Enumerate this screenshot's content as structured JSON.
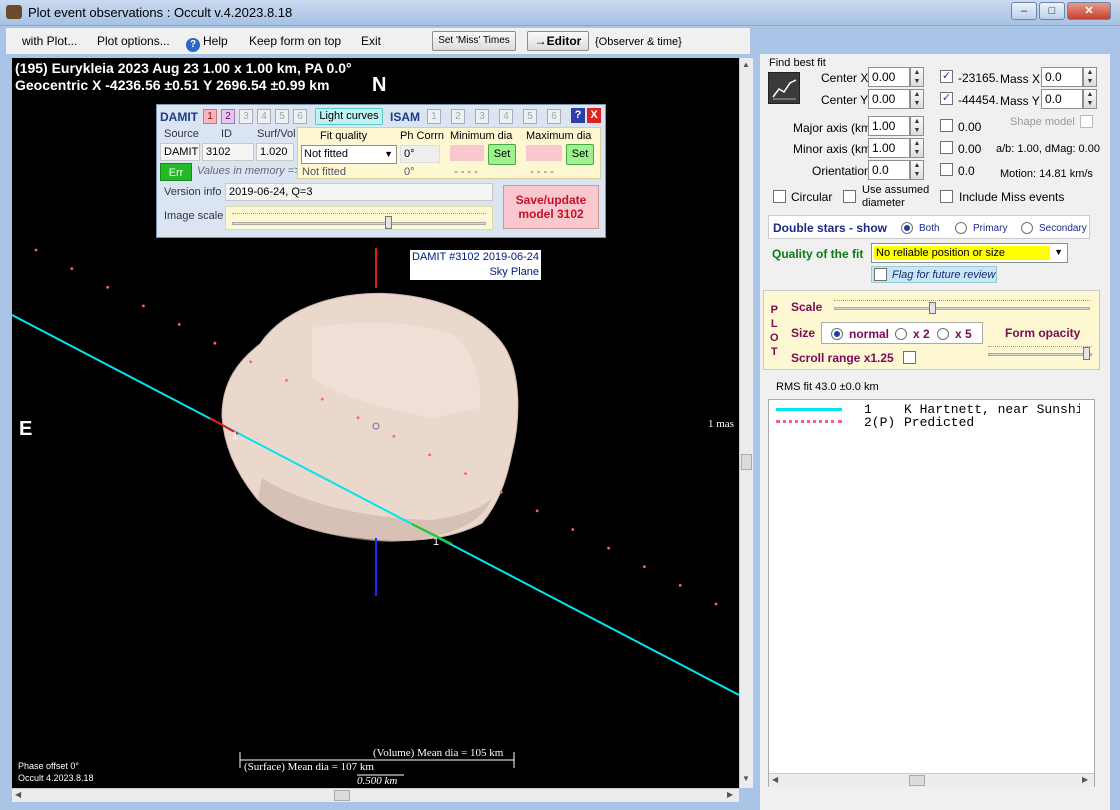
{
  "window": {
    "title": "Plot event observations : Occult v.4.2023.8.18"
  },
  "menu": {
    "with_plot": "with Plot...",
    "plot_options": "Plot options...",
    "help": "Help",
    "keep_on_top": "Keep form on top",
    "exit": "Exit",
    "set_miss_times": "Set 'Miss' Times",
    "editor": "→Editor",
    "observer_time": "{Observer & time}"
  },
  "plot": {
    "header_line1": "(195) Eurykleia  2023 Aug 23   1.00 x 1.00 km, PA 0.0°",
    "header_line2": "Geocentric  X  -4236.56 ±0.51  Y 2696.54 ±0.99 km",
    "north": "N",
    "east": "E",
    "model_label_line1": "DAMIT #3102 2019-06-24",
    "model_label_line2": "Sky Plane",
    "mas_label": "1 mas",
    "chord_label_a": "1",
    "chord_label_b": "1",
    "volume_dia": "(Volume) Mean dia = 105 km",
    "surface_dia": "(Surface) Mean dia = 107 km",
    "scale_km": "0.500 km",
    "phase_offset": "Phase offset 0°",
    "version": "Occult 4.2023.8.18"
  },
  "damit_panel": {
    "damit_label": "DAMIT",
    "model_numbers": [
      "1",
      "2",
      "3",
      "4",
      "5",
      "6"
    ],
    "light_curves": "Light curves",
    "isam_label": "ISAM",
    "isam_numbers": [
      "1",
      "2",
      "3",
      "4",
      "5",
      "6"
    ],
    "help_btn": "?",
    "close_btn": "X",
    "source_hdr": "Source",
    "id_hdr": "ID",
    "surfvol_hdr": "Surf/Vol",
    "source_val": "DAMIT",
    "id_val": "3102",
    "surfvol_val": "1.020",
    "err_btn": "Err",
    "values_in_memory": "Values in memory =>",
    "fit_quality_hdr": "Fit quality",
    "ph_corr_hdr": "Ph Corrn",
    "min_dia_hdr": "Minimum dia",
    "max_dia_hdr": "Maximum dia",
    "fit_select": "Not fitted",
    "fit_memory": "Not fitted",
    "ph_corr_val": "0°",
    "ph_corr_memory": "0°",
    "set_btn": "Set",
    "dashes": "- - - -",
    "version_info_label": "Version info",
    "version_info_val": "2019-06-24, Q=3",
    "image_scale_label": "Image scale",
    "image_scale_pos": 0.62,
    "save_update": "Save/update",
    "save_model": "model 3102"
  },
  "right_panel": {
    "find_best_fit": "Find best fit",
    "center_x_label": "Center X",
    "center_x": "0.00",
    "center_x_fit": "-23165.3",
    "center_y_label": "Center Y",
    "center_y": "0.00",
    "center_y_fit": "-44454.0",
    "mass_x_label": "Mass X",
    "mass_x": "0.0",
    "mass_y_label": "Mass Y",
    "mass_y": "0.0",
    "major_axis_label": "Major axis (km)",
    "major_axis": "1.00",
    "major_axis_fit": "0.00",
    "minor_axis_label": "Minor axis (km)",
    "minor_axis": "1.00",
    "minor_axis_fit": "0.00",
    "orientation_label": "Orientation",
    "orientation": "0.0",
    "orientation_fit": "0.0",
    "shape_model": "Shape model",
    "ab_dmag": "a/b: 1.00, dMag: 0.00",
    "motion": "Motion: 14.81 km/s",
    "circular": "Circular",
    "use_assumed_1": "Use assumed",
    "use_assumed_2": "diameter",
    "include_miss": "Include Miss events",
    "double_stars": "Double stars - show",
    "both": "Both",
    "primary": "Primary",
    "secondary": "Secondary",
    "quality_label": "Quality of the fit",
    "quality_value": "No reliable position or size",
    "flag_review": "Flag for future review",
    "plot_letters": [
      "P",
      "L",
      "O",
      "T"
    ],
    "scale_label": "Scale",
    "scale_pos": 0.38,
    "size_label": "Size",
    "normal": "normal",
    "x2": "x 2",
    "x5": "x 5",
    "form_opacity": "Form opacity",
    "opacity_pos": 0.98,
    "scroll_range": "Scroll range x1.25",
    "rms_fit": "RMS fit 43.0 ±0.0 km"
  },
  "legend": {
    "entries": [
      {
        "num": "1",
        "name": "K Hartnett, near Sunshi",
        "style": "solid",
        "color": "#00e5ee"
      },
      {
        "num": "2(P)",
        "name": "Predicted",
        "style": "dotted",
        "color": "#ff5c8a"
      }
    ]
  },
  "colors": {
    "chord": "#00e5ee",
    "predicted": "#ff5c8a",
    "asteroid": "#e9d6cc",
    "quality_bg": "#ffff00",
    "damit_save_bg": "#f9c8cf",
    "err_bg": "#22b826"
  }
}
